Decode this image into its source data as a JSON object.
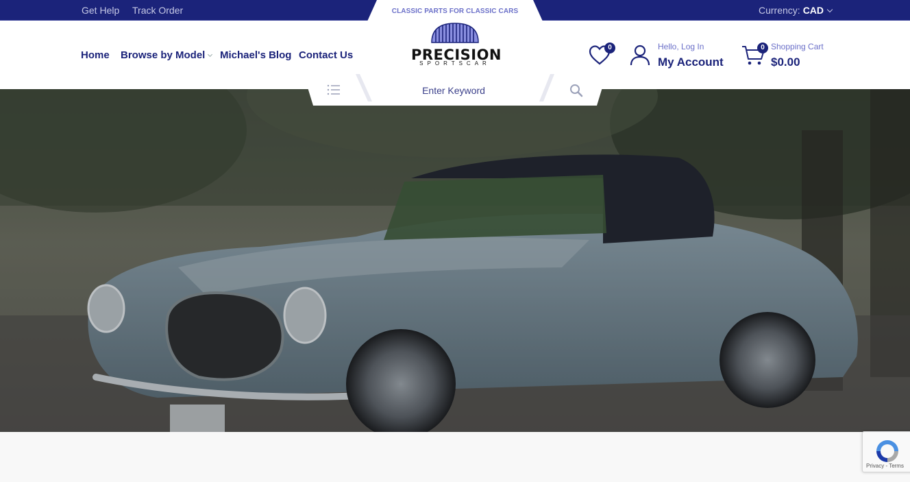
{
  "topbar": {
    "links": [
      "Get Help",
      "Track Order"
    ],
    "tagline": "CLASSIC PARTS FOR CLASSIC CARS",
    "currency_label": "Currency:",
    "currency_value": "CAD"
  },
  "brand": {
    "name": "PRECISION",
    "sub": "SPORTSCAR"
  },
  "nav": {
    "items": [
      {
        "label": "Home"
      },
      {
        "label": "Browse by Model"
      },
      {
        "label": "Michael's Blog"
      },
      {
        "label": "Contact Us"
      }
    ]
  },
  "wishlist": {
    "count": "0",
    "icon": "heart-icon"
  },
  "account": {
    "greeting": "Hello, Log In",
    "title": "My Account",
    "icon": "user-icon"
  },
  "cart": {
    "count": "0",
    "label": "Shopping Cart",
    "total": "$0.00",
    "icon": "cart-icon"
  },
  "search": {
    "placeholder": "Enter Keyword",
    "menu_icon": "list-icon",
    "button_icon": "search-icon"
  },
  "hero": {
    "image": "classic-roadster-photo"
  },
  "recaptcha": {
    "links": "Privacy - Terms"
  },
  "colors": {
    "brand_navy": "#1b237a",
    "accent_purple": "#6a6fc8"
  }
}
